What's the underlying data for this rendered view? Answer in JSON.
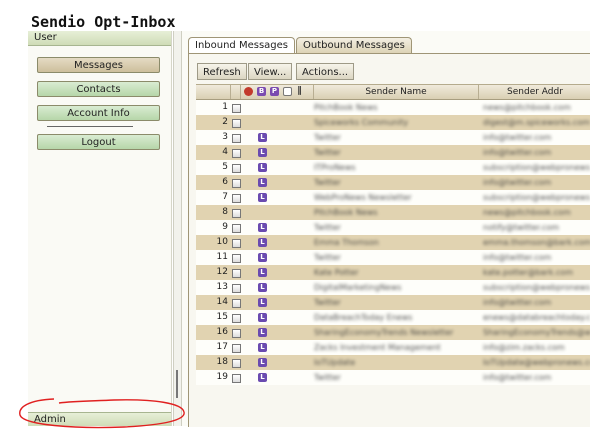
{
  "app": {
    "title": "Sendio Opt-Inbox"
  },
  "sidebar": {
    "header": "User",
    "footer": "Admin",
    "items": [
      {
        "label": "Messages",
        "style": "brown"
      },
      {
        "label": "Contacts",
        "style": "green"
      },
      {
        "label": "Account Info",
        "style": "green"
      },
      {
        "label": "Logout",
        "style": "green"
      }
    ]
  },
  "tabs": [
    {
      "label": "Inbound Messages",
      "active": true
    },
    {
      "label": "Outbound Messages",
      "active": false
    }
  ],
  "toolbar": {
    "refresh": "Refresh",
    "view": "View...",
    "actions": "Actions..."
  },
  "table": {
    "columns": {
      "sender_name": "Sender Name",
      "sender_addr": "Sender Addr"
    },
    "header_icons": [
      "status-icon",
      "b-icon",
      "p-icon",
      "note-icon",
      "attachment-icon"
    ],
    "rows": [
      {
        "num": "1",
        "flag": false,
        "name": "PitchBook News",
        "addr": "news@pitchbook.com"
      },
      {
        "num": "2",
        "flag": false,
        "name": "Spiceworks Community",
        "addr": "digest@m.spiceworks.com"
      },
      {
        "num": "3",
        "flag": true,
        "name": "Twitter",
        "addr": "info@twitter.com"
      },
      {
        "num": "4",
        "flag": true,
        "name": "Twitter",
        "addr": "info@twitter.com"
      },
      {
        "num": "5",
        "flag": true,
        "name": "ITProNews",
        "addr": "subscription@webpronews.com"
      },
      {
        "num": "6",
        "flag": true,
        "name": "Twitter",
        "addr": "info@twitter.com"
      },
      {
        "num": "7",
        "flag": true,
        "name": "WebProNews Newsletter",
        "addr": "subscription@webpronews.com"
      },
      {
        "num": "8",
        "flag": false,
        "name": "PitchBook News",
        "addr": "news@pitchbook.com"
      },
      {
        "num": "9",
        "flag": true,
        "name": "Twitter",
        "addr": "notify@twitter.com"
      },
      {
        "num": "10",
        "flag": true,
        "name": "Emma Thomson",
        "addr": "emma.thomson@bark.com"
      },
      {
        "num": "11",
        "flag": true,
        "name": "Twitter",
        "addr": "info@twitter.com"
      },
      {
        "num": "12",
        "flag": true,
        "name": "Kate Potter",
        "addr": "kate.potter@bark.com"
      },
      {
        "num": "13",
        "flag": true,
        "name": "DigitalMarketingNews",
        "addr": "subscription@webpronews.com"
      },
      {
        "num": "14",
        "flag": true,
        "name": "Twitter",
        "addr": "info@twitter.com"
      },
      {
        "num": "15",
        "flag": true,
        "name": "DataBreachToday Enews",
        "addr": "enews@databreachtoday.com"
      },
      {
        "num": "16",
        "flag": true,
        "name": "SharingEconomyTrends Newsletter",
        "addr": "SharingEconomyTrends@webpronews.com"
      },
      {
        "num": "17",
        "flag": true,
        "name": "Zacks Investment Management",
        "addr": "info@zim.zacks.com"
      },
      {
        "num": "18",
        "flag": true,
        "name": "IoTUpdate",
        "addr": "IoTUpdate@webpronews.com"
      },
      {
        "num": "19",
        "flag": true,
        "name": "Twitter",
        "addr": "info@twitter.com"
      }
    ]
  },
  "colors": {
    "accent_green": "#b6d6a9",
    "row_alt": "#e1d3b1",
    "flag_purple": "#6a4bb0",
    "annotation_red": "#e02020"
  }
}
